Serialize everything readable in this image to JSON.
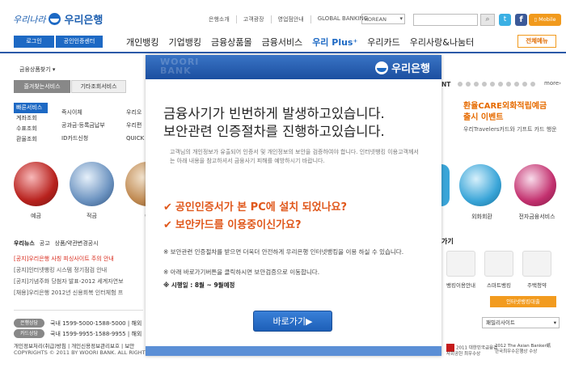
{
  "header": {
    "logo_script": "우리나라",
    "logo_name": "우리은행",
    "top_links": [
      "은행소개",
      "고객광장",
      "영업점안내",
      "GLOBAL BANKING"
    ],
    "language": "KOREAN",
    "mobile": "Mobile",
    "login": "로그인",
    "cert_center": "공인인증센터",
    "gnb": [
      "개인뱅킹",
      "기업뱅킹",
      "금융상품몰",
      "금융서비스",
      "우리 Plus⁺",
      "우리카드",
      "우리사랑&나눔터"
    ],
    "all_menu": "전체메뉴"
  },
  "left": {
    "category": "금융상품찾기 ▾",
    "tab_fav": "즐겨찾는서비스",
    "tab_other": "기타조회서비스",
    "quick_side": [
      "빠른서비스",
      "계좌조회",
      "수표조회",
      "환율조회"
    ],
    "quick_links1": [
      "즉시이체",
      "공과금·등록금납부",
      "ID카드신청"
    ],
    "quick_links2": [
      "우리오",
      "우리편",
      "QUICK"
    ],
    "circles": [
      "예금",
      "적금",
      "예"
    ],
    "news_head": [
      "우리뉴스",
      "공고",
      "상품/약관변경공시"
    ],
    "news": [
      "[공지]우리은행 사칭 피싱사이트 주의 안내",
      "[공지]인터넷뱅킹 시스템 정기점검 안내",
      "[공지]기념주화 당첨자 발표-2012 세계자연보",
      "[채용]우리은행 2012년 신용회복 인터체험 프"
    ],
    "call_center": "은행상담",
    "call_numbers": "국내 1599-5000·1588-5000 | 해외",
    "card_center": "카드상담",
    "card_numbers": "국내 1599-9955·1588-9955 | 해외",
    "footer": "개인정보처리(취급)방침 | 개인신용정보관리보호 | 보안",
    "copyright": "COPYRIGHTS © 2011 BY WOORI BANK. ALL RIGHTS"
  },
  "right": {
    "nt": "NT",
    "more": "more›",
    "event_title": "환율CARE외화적립예금\n출시 이벤트",
    "event_sub": "우리Travelers카드와 기프트 카드 행운",
    "circles": [
      "외화회환",
      "전자금융서비스"
    ],
    "gi": "가기",
    "squares": [
      "뱅킹이용안내",
      "스마트뱅킹",
      "주택청약"
    ],
    "orange_bar": "인터넷뱅킹대출",
    "family_site": "패밀리사이트",
    "award1": "2011 대한민국금융감\n사회공헌 최우수상",
    "award2": "2012 The Asian Banker紙\n한국최우수은행상 수상"
  },
  "popup": {
    "watermark": "WOORI\nBANK",
    "logo": "우리은행",
    "headline1": "금융사기가 빈번하게 발생하고있습니다.",
    "headline2": "보안관련 인증절차를 진행하고있습니다.",
    "desc": "고객님의 개인정보가 유출되어 인증서 및 개인정보의 보안을 검증하여야 합니다. 인터넷뱅킹 이용고객께서는 아래 내용을 참고하셔서 금융사기 피해를 예방하시기 바랍니다.",
    "check1": "공인인증서가 본 PC에 설치 되었나요?",
    "check2": "보안카드를 이용중이신가요?",
    "note1": "※ 보안관련 인증절차를 받으면 더욱더 안전하게 우리은행 인터넷뱅킹을 이용 하실 수 있습니다.",
    "note2": "※ 아래 바로가기버튼을 클릭하시면 보안검증으로 이동합니다.",
    "time": "※ 시행일 : 8월 ~ 9월예정",
    "go_button": "바로가기▶"
  }
}
